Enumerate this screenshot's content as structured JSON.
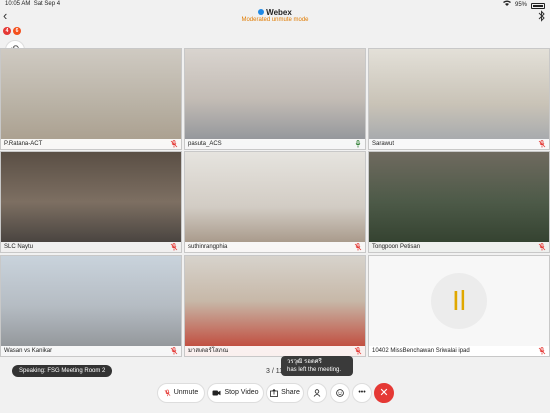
{
  "status": {
    "time": "10:05 AM",
    "date": "Sat Sep 4",
    "battery": "95%"
  },
  "header": {
    "title": "Webex",
    "subtitle": "Moderated unmute mode"
  },
  "badges": [
    "4",
    "6"
  ],
  "participants": [
    {
      "name": "P.Ratana-ACT",
      "mic": "muted"
    },
    {
      "name": "pasuta_ACS",
      "mic": "on"
    },
    {
      "name": "Sarawut",
      "mic": "muted"
    },
    {
      "name": "SLC Naytu",
      "mic": "muted"
    },
    {
      "name": "suthinrangphia",
      "mic": "muted"
    },
    {
      "name": "Tongpoon Petisan",
      "mic": "muted"
    },
    {
      "name": "Wasan vs Kanikar",
      "mic": "muted"
    },
    {
      "name": "มาสเตอร์โสภณ",
      "mic": "muted"
    },
    {
      "name": "10402 MissBenchawan Sriwalai ipad",
      "mic": "muted",
      "avatar": "Il"
    }
  ],
  "speaking": "Speaking: FSG Meeting Room 2",
  "page_indicator": "3 / 11",
  "toast": {
    "name": "วรวุฒิ รอดศรี",
    "message": "has left the meeting."
  },
  "controls": {
    "unmute": "Unmute",
    "stop_video": "Stop Video",
    "share": "Share"
  },
  "colors": {
    "accent": "#1e88e5",
    "mode_text": "#e07b00",
    "end_call": "#e53935",
    "muted_mic": "#e53935",
    "active_mic": "#2e7d32"
  }
}
